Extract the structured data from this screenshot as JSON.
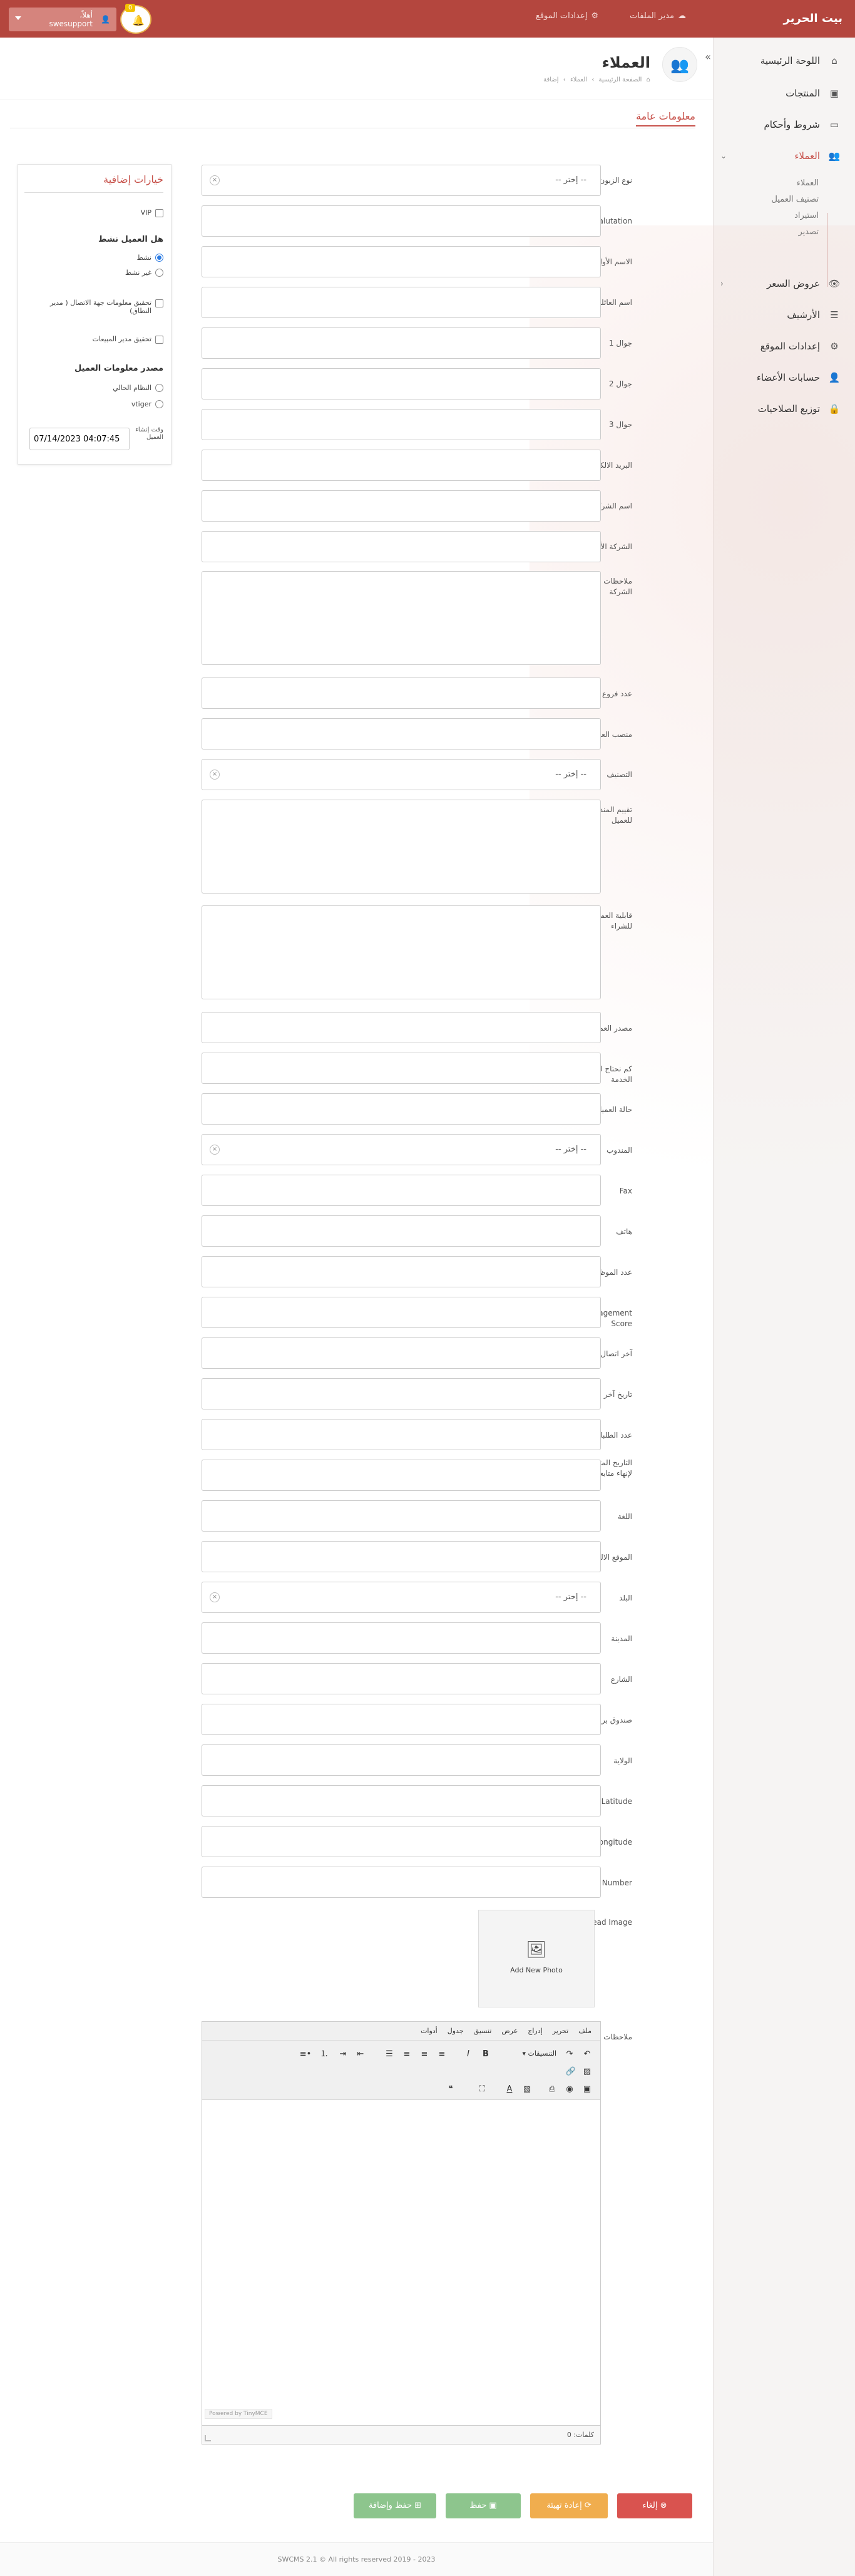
{
  "brand": "بيت الحرير",
  "topbar": {
    "file_manager": "مدير الملفات",
    "site_settings": "إعدادات الموقع",
    "user_greeting": "أهلاً،",
    "user_name": "swesupport",
    "notification_count": "0"
  },
  "sidebar": {
    "items": [
      {
        "label": "اللوحة الرئيسية",
        "icon": "home-icon"
      },
      {
        "label": "المنتجات",
        "icon": "briefcase-icon"
      },
      {
        "label": "شروط وأحكام",
        "icon": "card-icon"
      },
      {
        "label": "العملاء",
        "icon": "users-icon"
      },
      {
        "label": "عروض السعر",
        "icon": "eye-icon"
      },
      {
        "label": "الأرشيف",
        "icon": "bars-icon"
      },
      {
        "label": "إعدادات الموقع",
        "icon": "gear-icon"
      },
      {
        "label": "حسابات الأعضاء",
        "icon": "user-icon"
      },
      {
        "label": "توزيع الصلاحيات",
        "icon": "lock-icon"
      }
    ],
    "customers_sub": [
      "العملاء",
      "تصنيف العميل",
      "استيراد",
      "تصدير"
    ]
  },
  "header": {
    "title": "العملاء",
    "breadcrumb": [
      "الصفحة الرئيسية",
      "العملاء",
      "إضافة"
    ]
  },
  "tab": {
    "title": "معلومات عامة"
  },
  "form": {
    "select_placeholder": "-- إختر --",
    "labels": {
      "branch_type": "نوع الزبون",
      "salutation": "Salutation",
      "first_name": "الاسم الأول",
      "family_name": "اسم العائلة",
      "mobile1": "جوال 1",
      "mobile2": "جوال 2",
      "mobile3": "جوال 3",
      "email": "البريد الالكتروني",
      "company_name": "اسم الشركة",
      "parent_company": "الشركة الأم",
      "branch_notes": "ملاحظات فروع الشركة",
      "branch_count": "عدد فروع الشركة",
      "customer_position": "منصب العميل",
      "category": "التصنيف",
      "rep_evaluation": "تقييم المندوب للعميل",
      "purchase_ability": "قابلية العميل للشراء",
      "customer_source": "مصدر العميل",
      "scheduled_service": "كم نحتاج لعرض الخدمة",
      "customer_status": "حالة العميل",
      "representative": "المندوب",
      "fax": "Fax",
      "phone": "هاتف",
      "employees": "عدد الموظفين",
      "engagement": "Engagement Score",
      "last_contact_with": "آخر اتصال مع",
      "last_contact_date": "تاريخ آخر اتصال",
      "requests_count": "عدد الطلبات",
      "expected_end": "التاريخ المتوقع لإنهاء متابعة العميل",
      "language": "اللغة",
      "website": "الموقع الالكتروني",
      "country": "البلد",
      "city": "المدينة",
      "street": "الشارع",
      "postal": "صندوق بريد",
      "state": "الولاية",
      "latitude": "Latitude",
      "longitude": "Longitude",
      "lead_number": "Lead Number",
      "lead_image": "Lead Image",
      "notes": "ملاحظات"
    },
    "add_photo": "Add New Photo"
  },
  "editor": {
    "menu": [
      "ملف",
      "تحرير",
      "إدراج",
      "عرض",
      "تنسيق",
      "جدول",
      "أدوات"
    ],
    "formats_label": "التنسيقات",
    "powered_by": "Powered by TinyMCE",
    "word_count": "كلمات: 0"
  },
  "buttons": {
    "cancel": "إلغاء",
    "reset": "إعادة تهيئة",
    "save": "حفظ",
    "save_add": "حفظ وإضافة"
  },
  "panel": {
    "title": "خيارات إضافية",
    "vip": "VIP",
    "active_heading": "هل العميل نشط",
    "active": "نشط",
    "inactive": "غير نشط",
    "verify_contact": "تحقيق معلومات جهة الاتصال ( مدير النطاق)",
    "verify_sales": "تحقيق مدير المبيعات",
    "source_heading": "مصدر معلومات العميل",
    "source_current": "النظام الحالي",
    "source_vtiger": "vtiger",
    "datetime_label": "وقت إنشاء العميل",
    "datetime_value": "07/14/2023 04:07:45"
  },
  "footer": "SWCMS 2.1 © All rights reserved 2019 - 2023"
}
